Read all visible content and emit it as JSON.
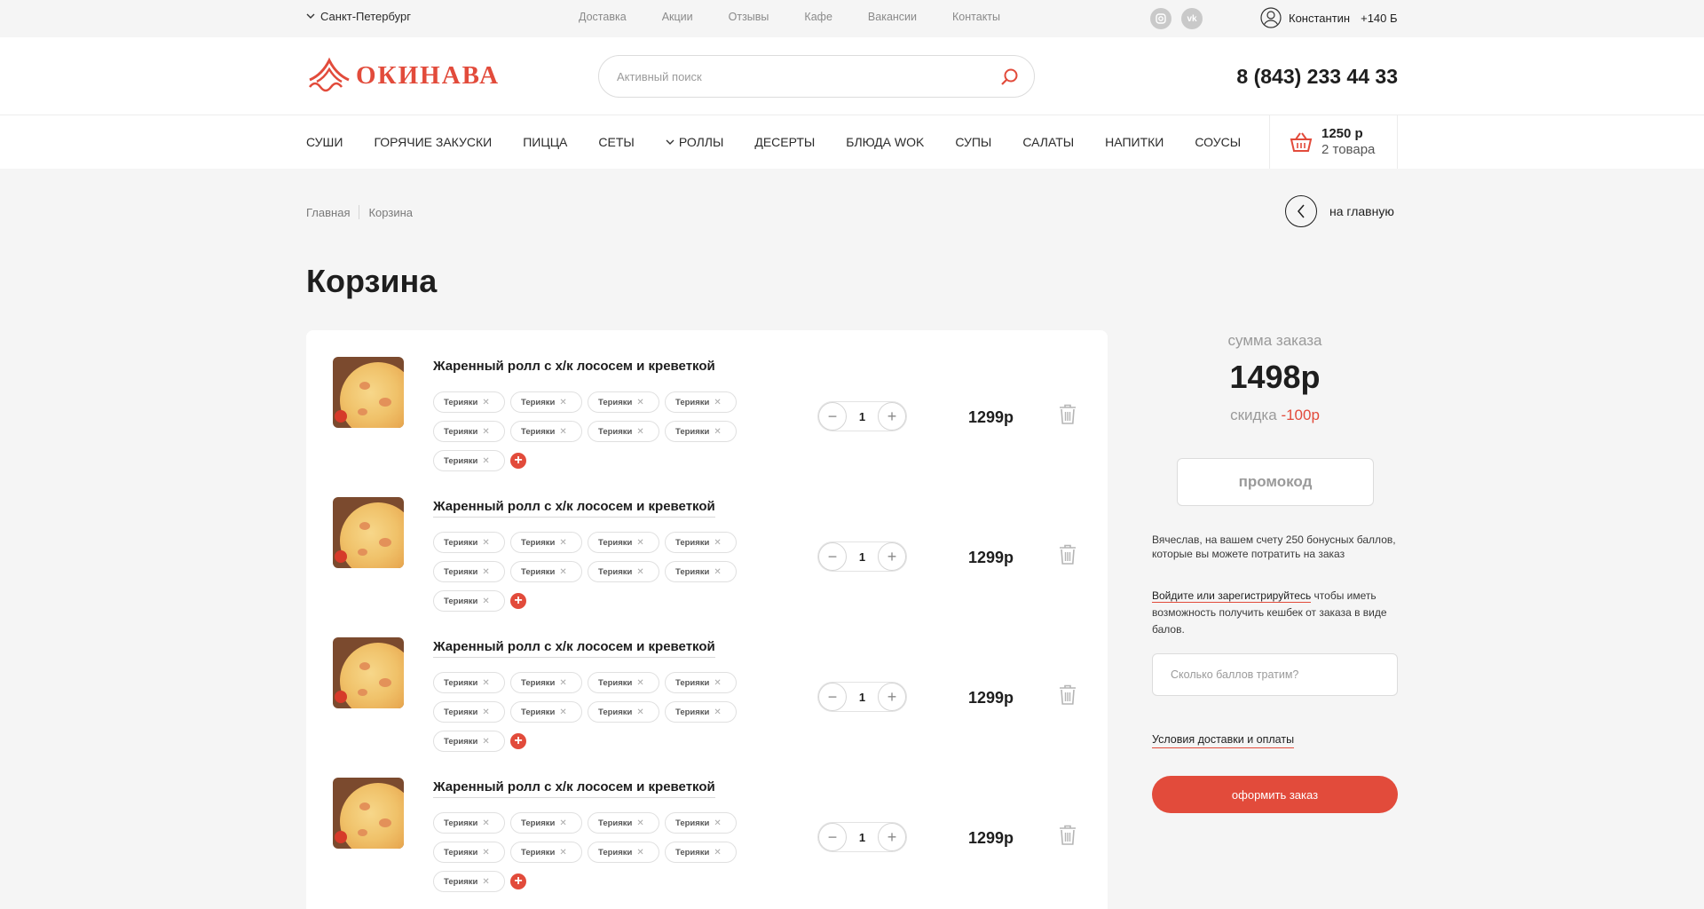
{
  "topbar": {
    "city": "Санкт-Петербург",
    "links": [
      "Доставка",
      "Акции",
      "Отзывы",
      "Кафе",
      "Вакансии",
      "Контакты"
    ],
    "social": [
      "instagram-icon",
      "vk-icon"
    ],
    "user": {
      "name": "Константин",
      "points": "+140 Б"
    }
  },
  "header": {
    "logo_text": "ОКИНАВА",
    "search_placeholder": "Активный поиск",
    "phone": "8 (843) 233 44 33"
  },
  "categories": [
    "СУШИ",
    "ГОРЯЧИЕ ЗАКУСКИ",
    "ПИЦЦА",
    "СЕТЫ",
    "РОЛЛЫ",
    "ДЕСЕРТЫ",
    "БЛЮДА WOK",
    "СУПЫ",
    "САЛАТЫ",
    "НАПИТКИ",
    "СОУСЫ"
  ],
  "cart_mini": {
    "sum": "1250 р",
    "count": "2 товара"
  },
  "breadcrumbs": [
    "Главная",
    "Корзина"
  ],
  "back_label": "на главную",
  "page_title": "Корзина",
  "cart_items": [
    {
      "name": "Жаренный ролл с х/к лососем и креветкой",
      "chips": [
        "Терияки",
        "Терияки",
        "Терияки",
        "Терияки",
        "Терияки",
        "Терияки",
        "Терияки",
        "Терияки",
        "Терияки"
      ],
      "qty": "1",
      "price": "1299р"
    },
    {
      "name": "Жаренный ролл с х/к лососем и креветкой",
      "chips": [
        "Терияки",
        "Терияки",
        "Терияки",
        "Терияки",
        "Терияки",
        "Терияки",
        "Терияки",
        "Терияки",
        "Терияки"
      ],
      "qty": "1",
      "price": "1299р"
    },
    {
      "name": "Жаренный ролл с х/к лососем и креветкой",
      "chips": [
        "Терияки",
        "Терияки",
        "Терияки",
        "Терияки",
        "Терияки",
        "Терияки",
        "Терияки",
        "Терияки",
        "Терияки"
      ],
      "qty": "1",
      "price": "1299р"
    },
    {
      "name": "Жаренный ролл с х/к лососем и креветкой",
      "chips": [
        "Терияки",
        "Терияки",
        "Терияки",
        "Терияки",
        "Терияки",
        "Терияки",
        "Терияки",
        "Терияки",
        "Терияки"
      ],
      "qty": "1",
      "price": "1299р"
    }
  ],
  "summary": {
    "label": "сумма заказа",
    "total": "1498р",
    "discount_label": "скидка",
    "discount_value": "-100р",
    "promo_label": "промокод",
    "bonus_text": "Вячеслав, на вашем счету 250 бонусных баллов, которые вы можете потратить на заказ",
    "login_link": "Войдите или зарегистрируйтесь",
    "login_rest": " чтобы иметь возможность получить кешбек от заказа в виде балов.",
    "points_placeholder": "Сколько баллов тратим?",
    "terms_link": "Условия доставки и оплаты",
    "order_button": "оформить заказ"
  },
  "colors": {
    "accent": "#e24b3b",
    "background": "#f5f5f5",
    "text": "#1e1e1e"
  }
}
